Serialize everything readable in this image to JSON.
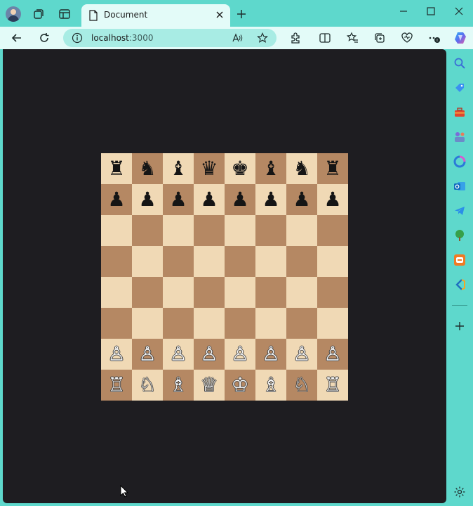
{
  "browser": {
    "tab_title": "Document",
    "url_host": "localhost",
    "url_port": ":3000"
  },
  "colors": {
    "frame": "#5ed8cc",
    "toolbar": "#e3fbf8",
    "content_bg": "#1e1d21",
    "board_light": "#f0d9b5",
    "board_dark": "#b58863"
  },
  "icons": {
    "titlebar": [
      "avatar",
      "workspaces-icon",
      "tab-actions-icon"
    ],
    "toolbar": [
      "back-icon",
      "refresh-icon",
      "info-icon",
      "read-aloud-icon",
      "favorite-star-icon",
      "extensions-icon",
      "split-screen-icon",
      "favorites-icon",
      "collections-icon",
      "browser-essentials-icon",
      "more-icon"
    ],
    "sidebar": [
      "copilot-icon",
      "search-icon",
      "shopping-icon",
      "tools-icon",
      "games-icon",
      "microsoft365-icon",
      "outlook-icon",
      "telegram-icon",
      "tree-icon",
      "app-icon",
      "vscode-icon",
      "add-icon",
      "settings-icon"
    ]
  },
  "board": {
    "rows": [
      [
        "♜",
        "♞",
        "♝",
        "♛",
        "♚",
        "♝",
        "♞",
        "♜"
      ],
      [
        "♟",
        "♟",
        "♟",
        "♟",
        "♟",
        "♟",
        "♟",
        "♟"
      ],
      [
        "",
        "",
        "",
        "",
        "",
        "",
        "",
        ""
      ],
      [
        "",
        "",
        "",
        "",
        "",
        "",
        "",
        ""
      ],
      [
        "",
        "",
        "",
        "",
        "",
        "",
        "",
        ""
      ],
      [
        "",
        "",
        "",
        "",
        "",
        "",
        "",
        ""
      ],
      [
        "♙",
        "♙",
        "♙",
        "♙",
        "♙",
        "♙",
        "♙",
        "♙"
      ],
      [
        "♖",
        "♘",
        "♗",
        "♕",
        "♔",
        "♗",
        "♘",
        "♖"
      ]
    ]
  }
}
